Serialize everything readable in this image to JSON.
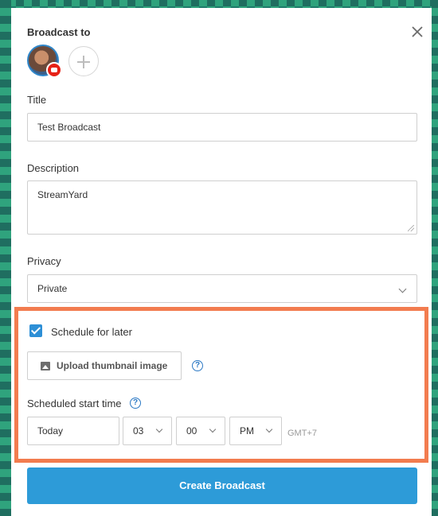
{
  "modal": {
    "broadcast_to_label": "Broadcast to",
    "title_label": "Title",
    "title_value": "Test Broadcast",
    "description_label": "Description",
    "description_value": "StreamYard",
    "privacy_label": "Privacy",
    "privacy_value": "Private",
    "schedule_label": "Schedule for later",
    "schedule_checked": true,
    "upload_thumbnail_label": "Upload thumbnail image",
    "scheduled_start_label": "Scheduled start time",
    "date_value": "Today",
    "hour_value": "03",
    "minute_value": "00",
    "ampm_value": "PM",
    "timezone": "GMT+7",
    "create_button": "Create Broadcast"
  },
  "icons": {
    "close": "close-icon",
    "destination": "youtube-icon",
    "add": "plus-icon",
    "image": "image-icon",
    "help": "help-icon"
  },
  "colors": {
    "accent": "#2d9bd8",
    "checkbox": "#2d8fd6",
    "highlight": "#f27c4f",
    "youtube": "#e62117"
  }
}
